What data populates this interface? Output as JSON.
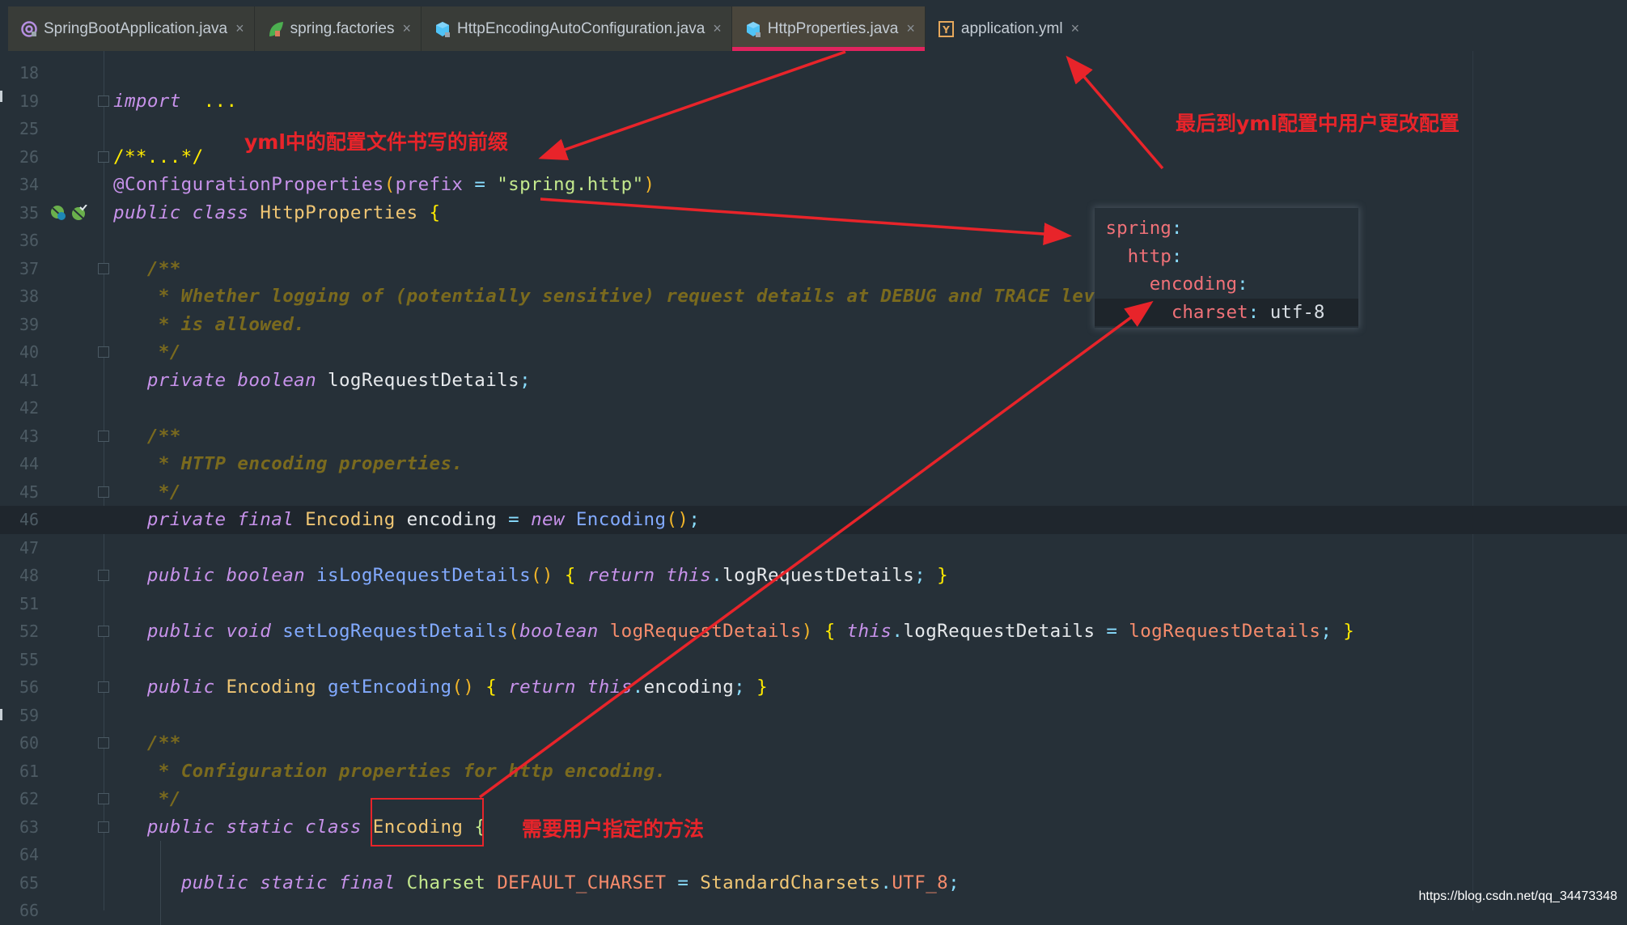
{
  "tabs": [
    {
      "label": "SpringBootApplication.java",
      "icon": "annotation-icon",
      "active": false
    },
    {
      "label": "spring.factories",
      "icon": "spring-leaf-icon",
      "active": false
    },
    {
      "label": "HttpEncodingAutoConfiguration.java",
      "icon": "class-cube-icon",
      "active": false
    },
    {
      "label": "HttpProperties.java",
      "icon": "class-cube-icon",
      "active": true
    },
    {
      "label": "application.yml",
      "icon": "yaml-icon",
      "active": false
    }
  ],
  "close_glyph": "×",
  "editor": {
    "lines": [
      {
        "n": "18",
        "fold": false,
        "parts": []
      },
      {
        "n": "19",
        "fold": "plus",
        "parts": [
          [
            "kw",
            "import"
          ],
          [
            "",
            "  "
          ],
          [
            "brc",
            "..."
          ]
        ]
      },
      {
        "n": "25",
        "fold": false,
        "parts": []
      },
      {
        "n": "26",
        "fold": "plus",
        "parts": [
          [
            "brc",
            "/**...*/"
          ]
        ]
      },
      {
        "n": "34",
        "fold": false,
        "parts": [
          [
            "ann",
            "@ConfigurationProperties"
          ],
          [
            "par",
            "("
          ],
          [
            "ann",
            "prefix"
          ],
          [
            "",
            " "
          ],
          [
            "pu",
            "="
          ],
          [
            "",
            " "
          ],
          [
            "st",
            "\"spring.http\""
          ],
          [
            "par",
            ")"
          ]
        ]
      },
      {
        "n": "35",
        "fold": false,
        "icons": true,
        "parts": [
          [
            "kw",
            "public class"
          ],
          [
            "",
            " "
          ],
          [
            "ty",
            "HttpProperties"
          ],
          [
            "",
            " "
          ],
          [
            "brc",
            "{"
          ]
        ]
      },
      {
        "n": "36",
        "fold": false,
        "parts": []
      },
      {
        "n": "37",
        "fold": "minus",
        "parts": [
          [
            "",
            "   "
          ],
          [
            "cm",
            "/**"
          ]
        ]
      },
      {
        "n": "38",
        "fold": false,
        "parts": [
          [
            "",
            "    "
          ],
          [
            "cm",
            "* Whether logging of (potentially sensitive) request details at DEBUG and TRACE level"
          ]
        ]
      },
      {
        "n": "39",
        "fold": false,
        "parts": [
          [
            "",
            "    "
          ],
          [
            "cm",
            "* is allowed."
          ]
        ]
      },
      {
        "n": "40",
        "fold": "minus",
        "parts": [
          [
            "",
            "    "
          ],
          [
            "cm",
            "*/"
          ]
        ]
      },
      {
        "n": "41",
        "fold": false,
        "parts": [
          [
            "",
            "   "
          ],
          [
            "kw",
            "private boolean"
          ],
          [
            "",
            " logRequestDetails"
          ],
          [
            "pu",
            ";"
          ]
        ]
      },
      {
        "n": "42",
        "fold": false,
        "parts": []
      },
      {
        "n": "43",
        "fold": "minus",
        "parts": [
          [
            "",
            "   "
          ],
          [
            "cm",
            "/**"
          ]
        ]
      },
      {
        "n": "44",
        "fold": false,
        "parts": [
          [
            "",
            "    "
          ],
          [
            "cm",
            "* HTTP encoding properties."
          ]
        ]
      },
      {
        "n": "45",
        "fold": "minus",
        "parts": [
          [
            "",
            "    "
          ],
          [
            "cm",
            "*/"
          ]
        ]
      },
      {
        "n": "46",
        "fold": false,
        "current": true,
        "parts": [
          [
            "",
            "   "
          ],
          [
            "kw",
            "private final"
          ],
          [
            "",
            " "
          ],
          [
            "ty",
            "Encoding"
          ],
          [
            "",
            " encoding "
          ],
          [
            "pu",
            "="
          ],
          [
            "",
            " "
          ],
          [
            "kw",
            "new"
          ],
          [
            "",
            " "
          ],
          [
            "fn",
            "Encoding"
          ],
          [
            "par",
            "()"
          ],
          [
            "pu",
            ";"
          ]
        ]
      },
      {
        "n": "47",
        "fold": false,
        "parts": []
      },
      {
        "n": "48",
        "fold": "plus",
        "parts": [
          [
            "",
            "   "
          ],
          [
            "kw",
            "public boolean"
          ],
          [
            "",
            " "
          ],
          [
            "fn",
            "isLogRequestDetails"
          ],
          [
            "par",
            "()"
          ],
          [
            "",
            " "
          ],
          [
            "brc",
            "{"
          ],
          [
            "",
            " "
          ],
          [
            "kw",
            "return this"
          ],
          [
            "pu",
            "."
          ],
          [
            "",
            "logRequestDetails"
          ],
          [
            "pu",
            ";"
          ],
          [
            "",
            " "
          ],
          [
            "brc",
            "}"
          ]
        ]
      },
      {
        "n": "51",
        "fold": false,
        "parts": []
      },
      {
        "n": "52",
        "fold": "plus",
        "parts": [
          [
            "",
            "   "
          ],
          [
            "kw",
            "public void"
          ],
          [
            "",
            " "
          ],
          [
            "fn",
            "setLogRequestDetails"
          ],
          [
            "par",
            "("
          ],
          [
            "kw",
            "boolean"
          ],
          [
            "",
            " "
          ],
          [
            "pa",
            "logRequestDetails"
          ],
          [
            "par",
            ")"
          ],
          [
            "",
            " "
          ],
          [
            "brc",
            "{"
          ],
          [
            "",
            " "
          ],
          [
            "kw",
            "this"
          ],
          [
            "pu",
            "."
          ],
          [
            "",
            "logRequestDetails "
          ],
          [
            "pu",
            "="
          ],
          [
            "",
            " "
          ],
          [
            "pa",
            "logRequestDetails"
          ],
          [
            "pu",
            ";"
          ],
          [
            "",
            " "
          ],
          [
            "brc",
            "}"
          ]
        ]
      },
      {
        "n": "55",
        "fold": false,
        "parts": []
      },
      {
        "n": "56",
        "fold": "plus",
        "parts": [
          [
            "",
            "   "
          ],
          [
            "kw",
            "public"
          ],
          [
            "",
            " "
          ],
          [
            "ty",
            "Encoding"
          ],
          [
            "",
            " "
          ],
          [
            "fn",
            "getEncoding"
          ],
          [
            "par",
            "()"
          ],
          [
            "",
            " "
          ],
          [
            "brc",
            "{"
          ],
          [
            "",
            " "
          ],
          [
            "kw",
            "return this"
          ],
          [
            "pu",
            "."
          ],
          [
            "",
            "encoding"
          ],
          [
            "pu",
            ";"
          ],
          [
            "",
            " "
          ],
          [
            "brc",
            "}"
          ]
        ]
      },
      {
        "n": "59",
        "fold": false,
        "parts": []
      },
      {
        "n": "60",
        "fold": "minus",
        "parts": [
          [
            "",
            "   "
          ],
          [
            "cm",
            "/**"
          ]
        ]
      },
      {
        "n": "61",
        "fold": false,
        "parts": [
          [
            "",
            "    "
          ],
          [
            "cm",
            "* Configuration properties for http encoding."
          ]
        ]
      },
      {
        "n": "62",
        "fold": "minus",
        "parts": [
          [
            "",
            "    "
          ],
          [
            "cm",
            "*/"
          ]
        ]
      },
      {
        "n": "63",
        "fold": "minus",
        "parts": [
          [
            "",
            "   "
          ],
          [
            "kw",
            "public static class"
          ],
          [
            "",
            " "
          ],
          [
            "ty",
            "Encoding"
          ],
          [
            "",
            " "
          ],
          [
            "chs",
            "{"
          ]
        ]
      },
      {
        "n": "64",
        "fold": false,
        "parts": []
      },
      {
        "n": "65",
        "fold": false,
        "parts": [
          [
            "",
            "      "
          ],
          [
            "kw",
            "public static final"
          ],
          [
            "",
            " "
          ],
          [
            "chs",
            "Charset"
          ],
          [
            "",
            " "
          ],
          [
            "pa",
            "DEFAULT_CHARSET"
          ],
          [
            "",
            " "
          ],
          [
            "pu",
            "="
          ],
          [
            "",
            " "
          ],
          [
            "ty",
            "StandardCharsets"
          ],
          [
            "pu",
            "."
          ],
          [
            "pa",
            "UTF_8"
          ],
          [
            "pu",
            ";"
          ]
        ]
      },
      {
        "n": "66",
        "fold": false,
        "parts": []
      }
    ]
  },
  "yml_popup": {
    "lines": [
      {
        "indent": 0,
        "key": "spring",
        "value": ""
      },
      {
        "indent": 1,
        "key": "http",
        "value": ""
      },
      {
        "indent": 2,
        "key": "encoding",
        "value": ""
      },
      {
        "indent": 3,
        "key": "charset",
        "value": "utf-8",
        "current": true
      }
    ]
  },
  "annotations": {
    "prefix_note": "yml中的配置文件书写的前缀",
    "final_note": "最后到yml配置中用户更改配置",
    "method_note": "需要用户指定的方法",
    "accent_color": "#e8242a"
  },
  "watermark": "https://blog.csdn.net/qq_34473348"
}
